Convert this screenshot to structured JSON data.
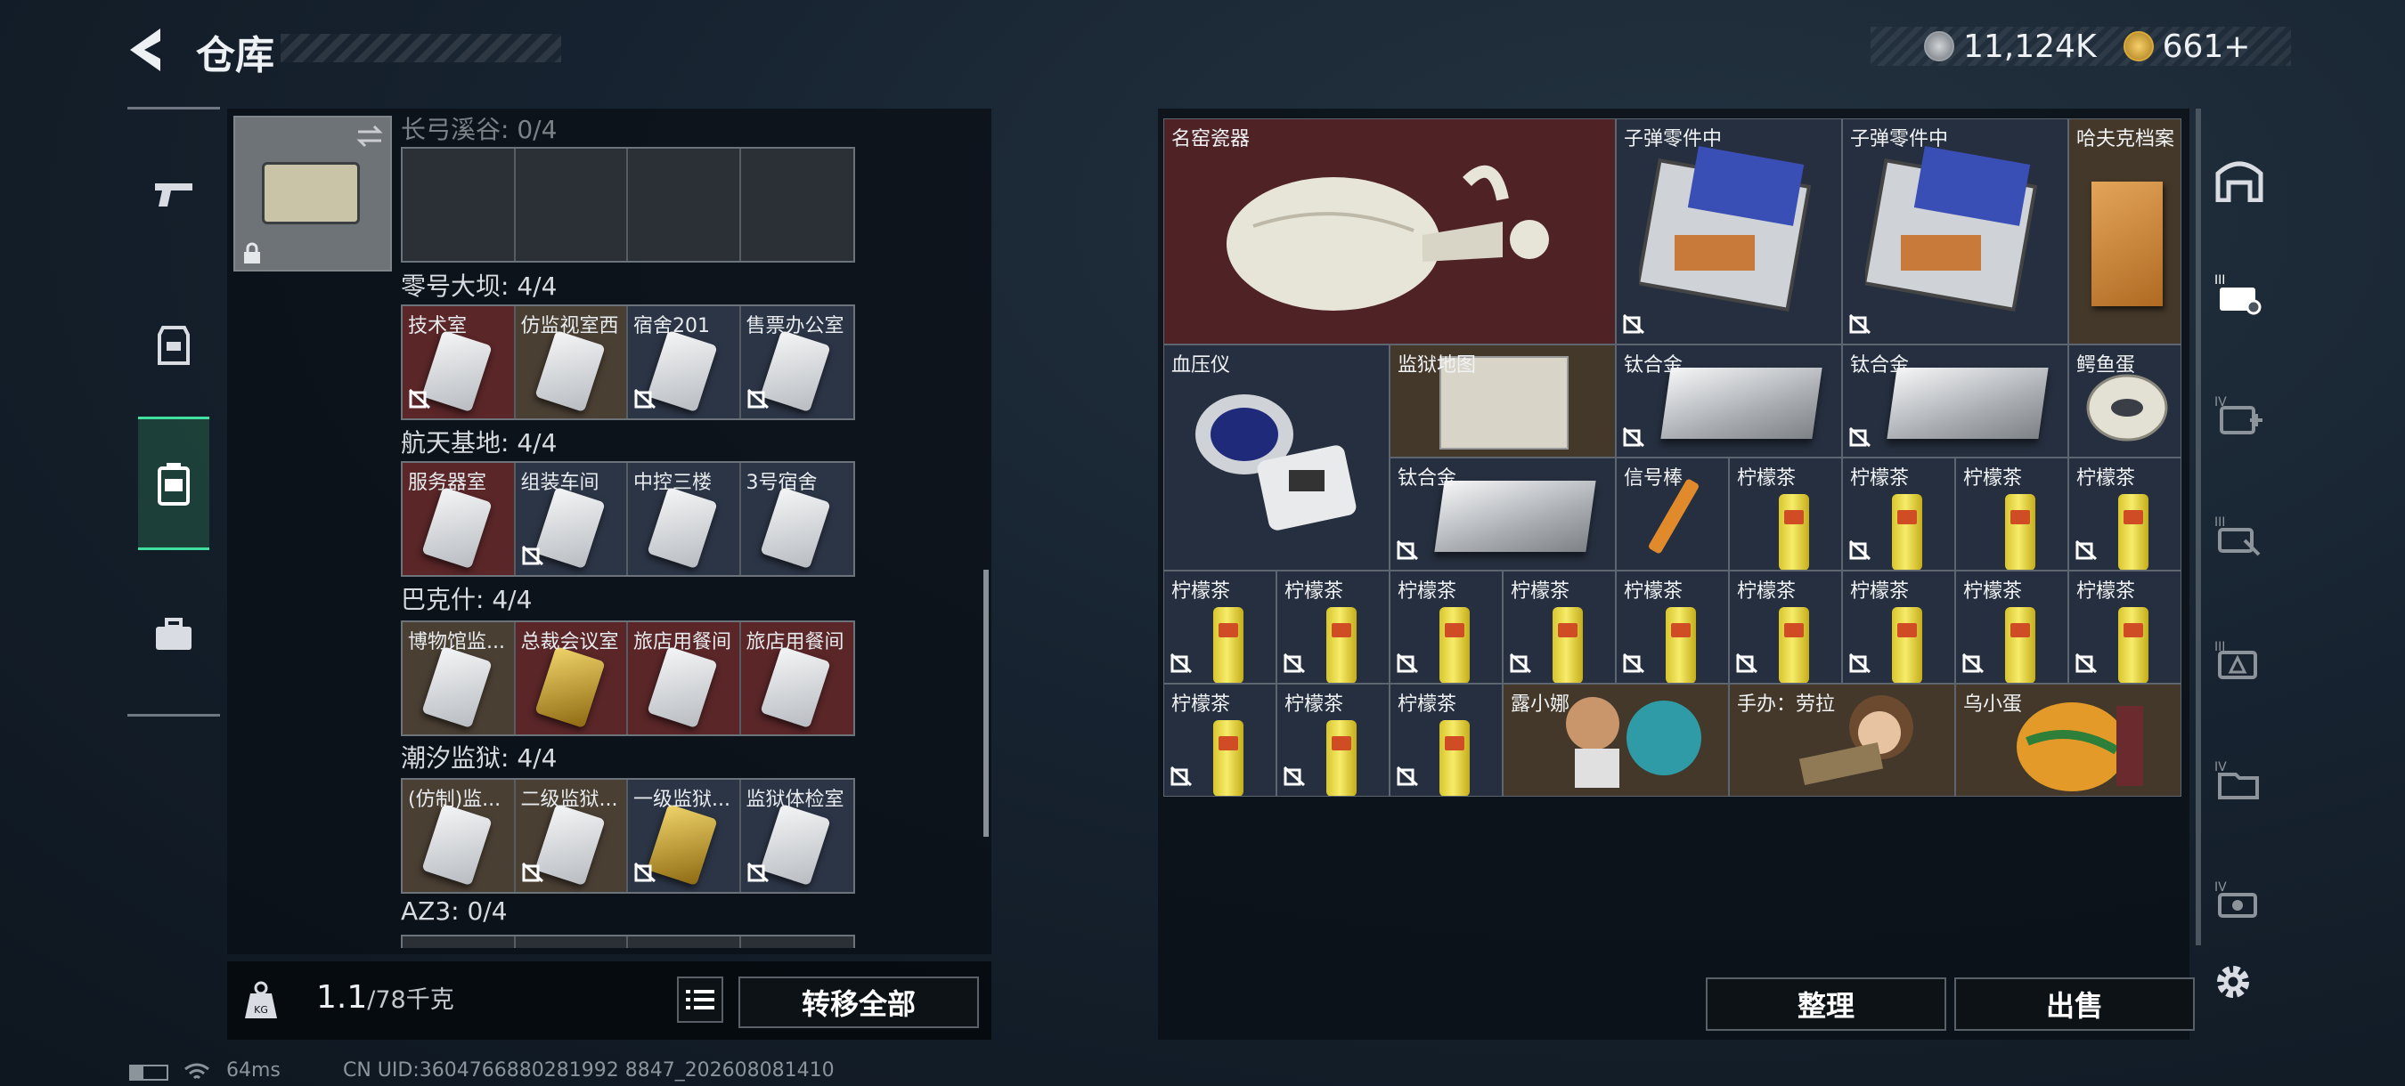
{
  "header": {
    "title": "仓库"
  },
  "currency": {
    "silver": "11,124K",
    "gold": "661+"
  },
  "keycard_sections": [
    {
      "title": "长弓溪谷: 0/4",
      "cells": []
    },
    {
      "title": "零号大坝: 4/4",
      "cells": [
        {
          "label": "技术室",
          "bg": "red",
          "locked": true
        },
        {
          "label": "仿监视室西",
          "bg": "brown",
          "locked": false
        },
        {
          "label": "宿舍201",
          "bg": "slate",
          "locked": true
        },
        {
          "label": "售票办公室",
          "bg": "slate",
          "locked": true
        }
      ]
    },
    {
      "title": "航天基地: 4/4",
      "cells": [
        {
          "label": "服务器室",
          "bg": "red",
          "locked": false
        },
        {
          "label": "组装车间",
          "bg": "slate",
          "locked": true
        },
        {
          "label": "中控三楼",
          "bg": "slate",
          "locked": false
        },
        {
          "label": "3号宿舍",
          "bg": "slate",
          "locked": false
        }
      ]
    },
    {
      "title": "巴克什: 4/4",
      "cells": [
        {
          "label": "博物馆监...",
          "bg": "brown",
          "locked": false
        },
        {
          "label": "总裁会议室",
          "bg": "red",
          "locked": false,
          "gold": true
        },
        {
          "label": "旅店用餐间",
          "bg": "red",
          "locked": false
        },
        {
          "label": "旅店用餐间",
          "bg": "red",
          "locked": false
        }
      ]
    },
    {
      "title": "潮汐监狱: 4/4",
      "cells": [
        {
          "label": "(仿制)监...",
          "bg": "brown",
          "locked": false
        },
        {
          "label": "二级监狱...",
          "bg": "brown",
          "locked": true
        },
        {
          "label": "一级监狱...",
          "bg": "slate",
          "locked": true,
          "gold": true
        },
        {
          "label": "监狱体检室",
          "bg": "slate",
          "locked": true
        }
      ]
    },
    {
      "title": "AZ3: 0/4",
      "cells": []
    }
  ],
  "bottom": {
    "weight_value": "1.1",
    "weight_cap": "/78千克",
    "transfer_all": "转移全部"
  },
  "status": {
    "ping": "64ms",
    "uid": "CN UID:3604766880281992 8847_202608081410"
  },
  "stash_items": [
    {
      "id": "vase",
      "label": "名窑瓷器",
      "bg": "red",
      "locked": false
    },
    {
      "id": "ammo1",
      "label": "子弹零件中",
      "bg": "slate",
      "locked": true
    },
    {
      "id": "ammo2",
      "label": "子弹零件中",
      "bg": "slate",
      "locked": true
    },
    {
      "id": "file",
      "label": "哈夫克档案",
      "bg": "brown",
      "locked": false
    },
    {
      "id": "bp",
      "label": "血压仪",
      "bg": "slate",
      "locked": false
    },
    {
      "id": "map",
      "label": "监狱地图",
      "bg": "brown",
      "locked": false
    },
    {
      "id": "ti1",
      "label": "钛合金",
      "bg": "slate",
      "locked": true
    },
    {
      "id": "ti2",
      "label": "钛合金",
      "bg": "slate",
      "locked": true
    },
    {
      "id": "egg",
      "label": "鳄鱼蛋",
      "bg": "slate",
      "locked": false
    },
    {
      "id": "ti3",
      "label": "钛合金",
      "bg": "slate",
      "locked": true
    },
    {
      "id": "flare",
      "label": "信号棒",
      "bg": "slate",
      "locked": false
    },
    {
      "id": "t1",
      "label": "柠檬茶",
      "bg": "slate",
      "locked": false
    },
    {
      "id": "t2",
      "label": "柠檬茶",
      "bg": "slate",
      "locked": true
    },
    {
      "id": "t3",
      "label": "柠檬茶",
      "bg": "slate",
      "locked": false
    },
    {
      "id": "t4",
      "label": "柠檬茶",
      "bg": "slate",
      "locked": true
    },
    {
      "id": "t5",
      "label": "柠檬茶",
      "bg": "slate",
      "locked": true
    },
    {
      "id": "t6",
      "label": "柠檬茶",
      "bg": "slate",
      "locked": true
    },
    {
      "id": "t7",
      "label": "柠檬茶",
      "bg": "slate",
      "locked": true
    },
    {
      "id": "t8",
      "label": "柠檬茶",
      "bg": "slate",
      "locked": true
    },
    {
      "id": "t9",
      "label": "柠檬茶",
      "bg": "slate",
      "locked": true
    },
    {
      "id": "t10",
      "label": "柠檬茶",
      "bg": "slate",
      "locked": true
    },
    {
      "id": "t11",
      "label": "柠檬茶",
      "bg": "slate",
      "locked": true
    },
    {
      "id": "t12",
      "label": "柠檬茶",
      "bg": "slate",
      "locked": true
    },
    {
      "id": "t13",
      "label": "柠檬茶",
      "bg": "slate",
      "locked": true
    },
    {
      "id": "t14",
      "label": "柠檬茶",
      "bg": "slate",
      "locked": true
    },
    {
      "id": "t15",
      "label": "柠檬茶",
      "bg": "slate",
      "locked": true
    },
    {
      "id": "t16",
      "label": "柠檬茶",
      "bg": "slate",
      "locked": true
    },
    {
      "id": "lu",
      "label": "露小娜",
      "bg": "brown",
      "locked": false
    },
    {
      "id": "fig",
      "label": "手办：劳拉",
      "bg": "brown",
      "locked": false
    },
    {
      "id": "wu",
      "label": "乌小蛋",
      "bg": "brown",
      "locked": false
    }
  ],
  "actions": {
    "sort": "整理",
    "sell": "出售"
  },
  "right_nav": [
    "warehouse-icon",
    "tier3-case-icon",
    "tier4-medkit-icon",
    "tier3-tool-icon",
    "tier3-ammo-icon",
    "tier4-file-icon",
    "tier4-gear-icon"
  ],
  "colors": {
    "accent": "#3fe0a0",
    "red_cell": "#5a2628",
    "slate_cell": "#2c3546",
    "brown_cell": "#4a3f33"
  }
}
